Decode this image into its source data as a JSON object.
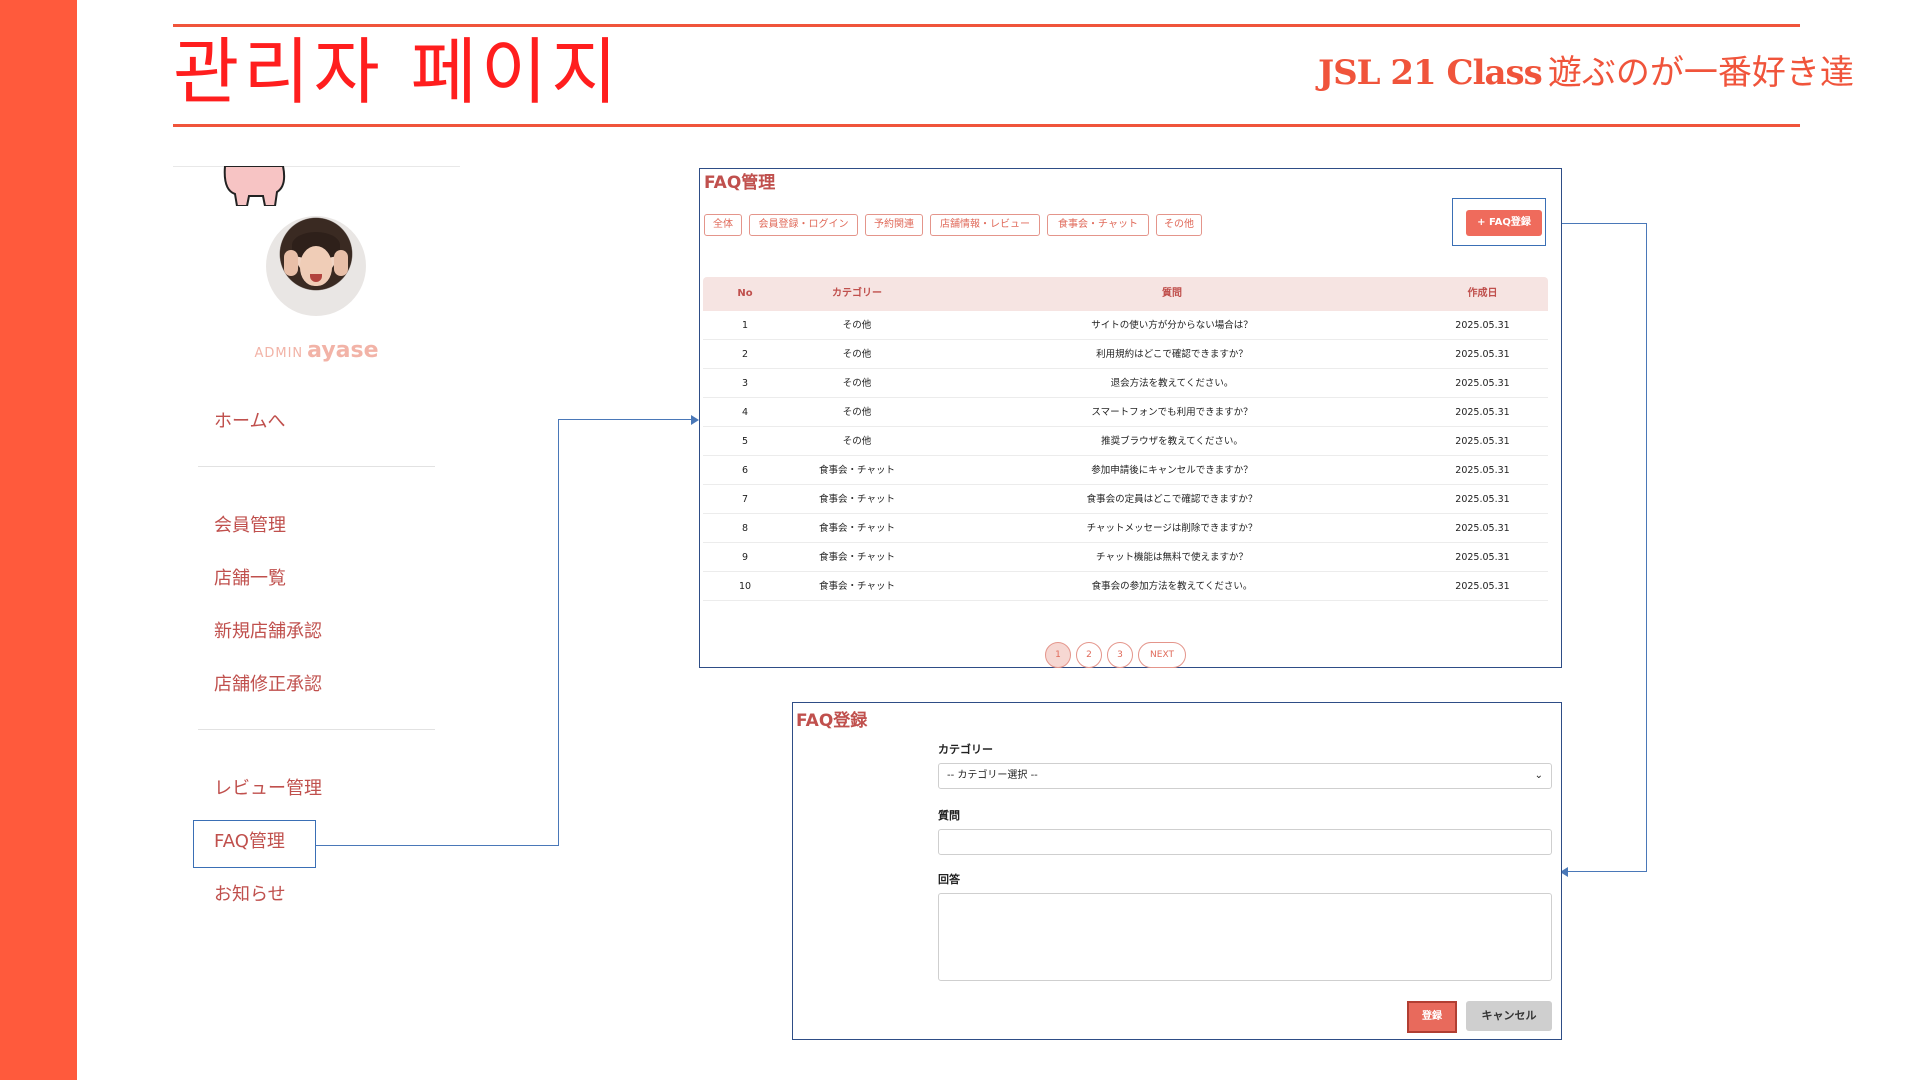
{
  "header": {
    "title": "관리자 페이지",
    "brand": "JSL 21 Class",
    "tagline": "遊ぶのが一番好き達"
  },
  "sidebar": {
    "admin_label": "ADMIN",
    "admin_name": "ayase",
    "items": [
      {
        "label": "ホームへ"
      },
      {
        "label": "会員管理"
      },
      {
        "label": "店舗一覧"
      },
      {
        "label": "新規店舗承認"
      },
      {
        "label": "店舗修正承認"
      },
      {
        "label": "レビュー管理"
      },
      {
        "label": "FAQ管理",
        "active": true
      },
      {
        "label": "お知らせ"
      }
    ]
  },
  "faq_list": {
    "title": "FAQ管理",
    "filters": [
      "全体",
      "会員登録・ログイン",
      "予約関連",
      "店舗情報・レビュー",
      "食事会・チャット",
      "その他"
    ],
    "add_button": "+ FAQ登録",
    "columns": [
      "No",
      "カテゴリー",
      "質問",
      "作成日"
    ],
    "rows": [
      {
        "no": "1",
        "category": "その他",
        "question": "サイトの使い方が分からない場合は？",
        "date": "2025.05.31"
      },
      {
        "no": "2",
        "category": "その他",
        "question": "利用規約はどこで確認できますか？",
        "date": "2025.05.31"
      },
      {
        "no": "3",
        "category": "その他",
        "question": "退会方法を教えてください。",
        "date": "2025.05.31"
      },
      {
        "no": "4",
        "category": "その他",
        "question": "スマートフォンでも利用できますか？",
        "date": "2025.05.31"
      },
      {
        "no": "5",
        "category": "その他",
        "question": "推奨ブラウザを教えてください。",
        "date": "2025.05.31"
      },
      {
        "no": "6",
        "category": "食事会・チャット",
        "question": "参加申請後にキャンセルできますか？",
        "date": "2025.05.31"
      },
      {
        "no": "7",
        "category": "食事会・チャット",
        "question": "食事会の定員はどこで確認できますか？",
        "date": "2025.05.31"
      },
      {
        "no": "8",
        "category": "食事会・チャット",
        "question": "チャットメッセージは削除できますか？",
        "date": "2025.05.31"
      },
      {
        "no": "9",
        "category": "食事会・チャット",
        "question": "チャット機能は無料で使えますか？",
        "date": "2025.05.31"
      },
      {
        "no": "10",
        "category": "食事会・チャット",
        "question": "食事会の参加方法を教えてください。",
        "date": "2025.05.31"
      }
    ],
    "pagination": [
      "1",
      "2",
      "3",
      "NEXT"
    ],
    "current_page": "1"
  },
  "faq_form": {
    "title": "FAQ登録",
    "category_label": "カテゴリー",
    "category_value": "-- カテゴリー選択 --",
    "question_label": "質問",
    "question_value": "",
    "answer_label": "回答",
    "answer_value": "",
    "submit_label": "登録",
    "cancel_label": "キャンセル"
  },
  "colors": {
    "accent": "#ff5a3c",
    "title_red": "#ff1e1e",
    "text_red": "#c0504d",
    "connector_blue": "#4a78b8"
  }
}
